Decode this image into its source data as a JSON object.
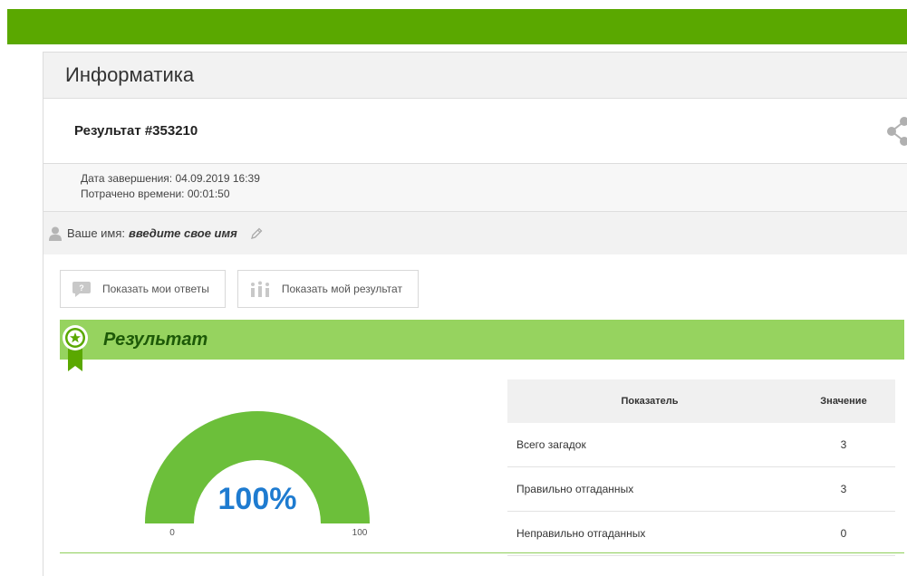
{
  "subject": "Информатика",
  "result": {
    "title": "Результат #353210",
    "completion_label": "Дата завершения: 04.09.2019 16:39",
    "time_label": "Потрачено времени: 00:01:50"
  },
  "user": {
    "name_label": "Ваше имя:",
    "name_value": "введите свое имя"
  },
  "buttons": {
    "show_answers": "Показать мои ответы",
    "show_result": "Показать мой результат"
  },
  "banner": {
    "title": "Результат"
  },
  "gauge": {
    "percent_text": "100%",
    "value": 100,
    "min_label": "0",
    "max_label": "100",
    "color": "#6cbf3a",
    "text_color": "#1e7bd0"
  },
  "table": {
    "headers": [
      "Показатель",
      "Значение"
    ],
    "rows": [
      {
        "label": "Всего загадок",
        "value": "3"
      },
      {
        "label": "Правильно отгаданных",
        "value": "3"
      },
      {
        "label": "Неправильно отгаданных",
        "value": "0"
      }
    ]
  },
  "colors": {
    "topbar": "#5aa800",
    "banner": "#96d35f",
    "banner_text": "#1d5a08"
  }
}
